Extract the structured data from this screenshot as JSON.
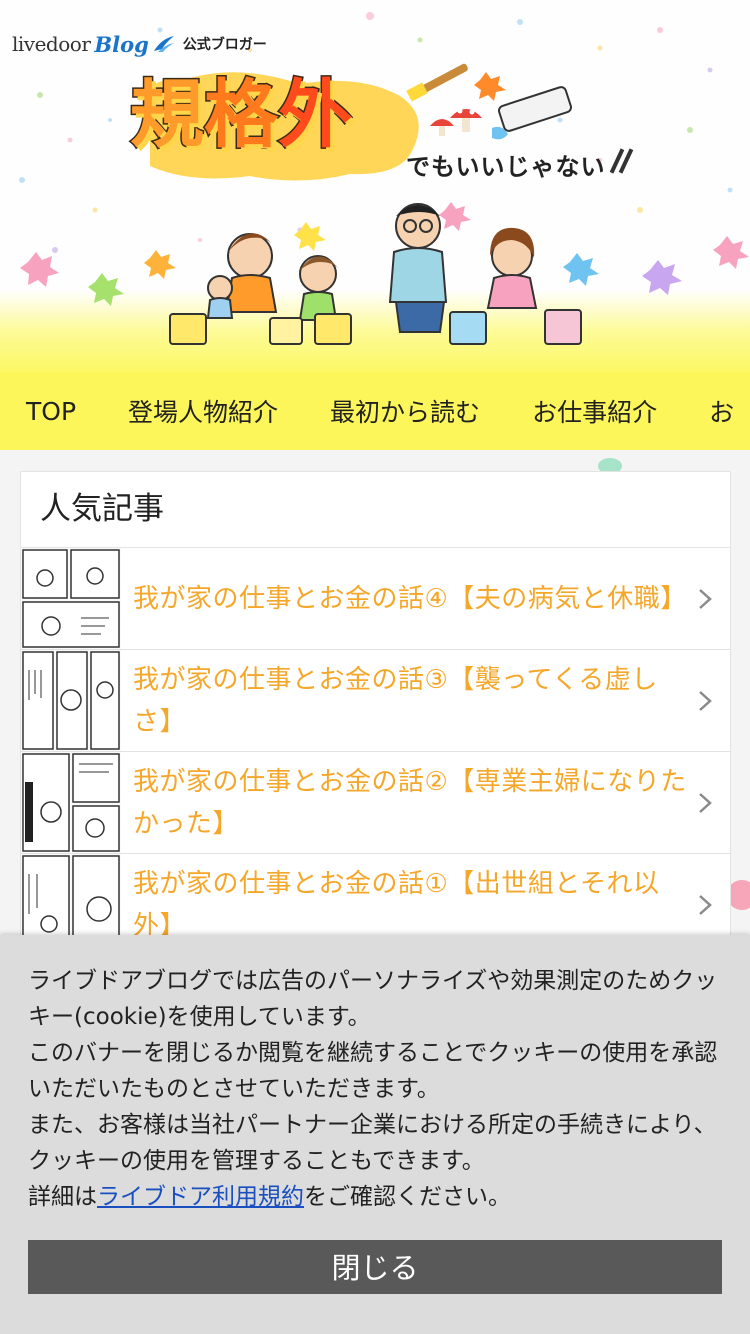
{
  "header": {
    "brand_livedoor": "livedoor",
    "brand_blog": "Blog",
    "brand_official": "公式ブロガー",
    "logo_chars": [
      "規",
      "格",
      "外"
    ],
    "logo_sub": "でもいいじゃない"
  },
  "nav": {
    "items": [
      "TOP",
      "登場人物紹介",
      "最初から読む",
      "お仕事紹介",
      "お"
    ]
  },
  "popular": {
    "title": "人気記事",
    "articles": [
      {
        "title": "我が家の仕事とお金の話④【夫の病気と休職】"
      },
      {
        "title": "我が家の仕事とお金の話③【襲ってくる虚しさ】"
      },
      {
        "title": "我が家の仕事とお金の話②【専業主婦になりたかった】"
      },
      {
        "title": "我が家の仕事とお金の話①【出世組とそれ以外】"
      }
    ]
  },
  "cookie": {
    "line1": "ライブドアブログでは広告のパーソナライズや効果測定のためクッキー(cookie)を使用しています。",
    "line2": "このバナーを閉じるか閲覧を継続することでクッキーの使用を承認いただいたものとさせていただきます。",
    "line3": "また、お客様は当社パートナー企業における所定の手続きにより、クッキーの使用を管理することもできます。",
    "detail_prefix": "詳細は",
    "detail_link": "ライブドア利用規約",
    "detail_suffix": "をご確認ください。",
    "close_label": "閉じる"
  },
  "colors": {
    "accent_text": "#f5a72a",
    "nav_bg": "#fcf65a",
    "cookie_bg": "#dcdcdc",
    "close_btn_bg": "#595959",
    "link": "#1a4fbf"
  },
  "icons": {
    "chevron": "chevron-right-icon"
  }
}
